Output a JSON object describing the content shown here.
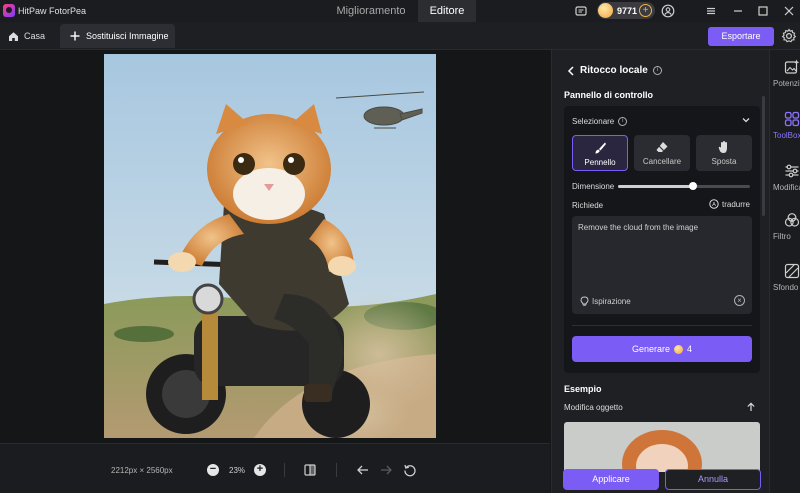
{
  "app": {
    "title": "HitPaw FotorPea"
  },
  "top_tabs": [
    {
      "label": "Miglioramento",
      "active": false
    },
    {
      "label": "Editore",
      "active": true
    }
  ],
  "credits": {
    "value": "9771"
  },
  "breadcrumb": {
    "home_label": "Casa",
    "active_tab_label": "Sostituisci Immagine"
  },
  "toolbar": {
    "export_label": "Esportare"
  },
  "canvas": {
    "image_dimensions": "2212px × 2560px",
    "zoom": "23%"
  },
  "panel": {
    "title": "Ritocco locale",
    "control_title": "Pannello di controllo",
    "select_label": "Selezionare",
    "tools": [
      {
        "label": "Pennello",
        "icon": "brush-icon",
        "active": true
      },
      {
        "label": "Cancellare",
        "icon": "eraser-icon",
        "active": false
      },
      {
        "label": "Sposta",
        "icon": "hand-icon",
        "active": false
      }
    ],
    "dimension_label": "Dimensione",
    "dimension_value": 0.57,
    "prompt_label": "Richiede",
    "translate_label": "tradurre",
    "prompt_text": "Remove the cloud from the image",
    "inspiration_label": "Ispirazione",
    "generate_label": "Generare",
    "generate_cost": "4",
    "example_title": "Esempio",
    "example_sub": "Modifica oggetto",
    "apply_label": "Applicare",
    "cancel_label": "Annulla"
  },
  "rail": [
    {
      "label": "Potenziamento",
      "icon": "sparkle-image-icon",
      "active": false
    },
    {
      "label": "ToolBox",
      "icon": "grid-icon",
      "active": true
    },
    {
      "label": "Modifica",
      "icon": "sliders-icon",
      "active": false
    },
    {
      "label": "Filtro",
      "icon": "filter-icon",
      "active": false
    },
    {
      "label": "Sfondo",
      "icon": "background-icon",
      "active": false
    }
  ],
  "colors": {
    "accent": "#7b5cf5",
    "background": "#151618",
    "panel": "#1f2024"
  }
}
